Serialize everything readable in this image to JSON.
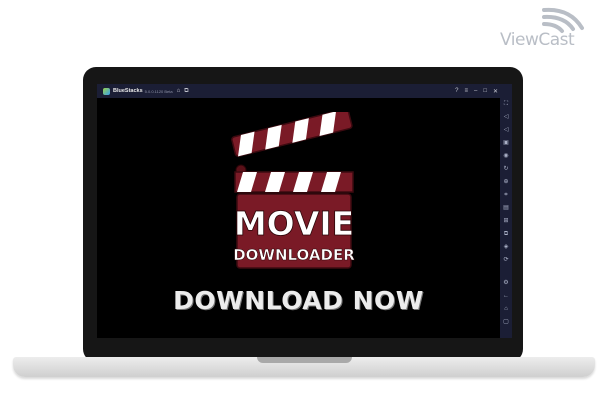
{
  "watermark": {
    "text": "ViewCast"
  },
  "emulator": {
    "app_name": "BlueStacks",
    "version": "5.0.0.1120 Beta",
    "titlebar_icons": [
      "home-icon",
      "multi-instance-icon"
    ],
    "window_controls": [
      "help-icon",
      "menu-icon",
      "minimize-icon",
      "maximize-icon",
      "close-icon"
    ],
    "sidebar_icons": [
      "fullscreen-icon",
      "volume-up-icon",
      "volume-down-icon",
      "screen-record-icon",
      "camera-icon",
      "rotate-icon",
      "controls-icon",
      "screenshot-icon",
      "media-folder-icon",
      "apk-install-icon",
      "macro-icon",
      "eco-mode-icon",
      "sync-icon",
      "settings-icon",
      "back-icon",
      "home-icon",
      "recent-apps-icon"
    ]
  },
  "game": {
    "logo_line1": "MOVIE",
    "logo_line2": "DOWNLOADER",
    "cta": "DOWNLOAD NOW"
  },
  "colors": {
    "clapper_maroon": "#7a1a26",
    "clapper_stripe": "#ffffff",
    "titlebar": "#1b1e35",
    "watermark": "#b9bec6"
  }
}
